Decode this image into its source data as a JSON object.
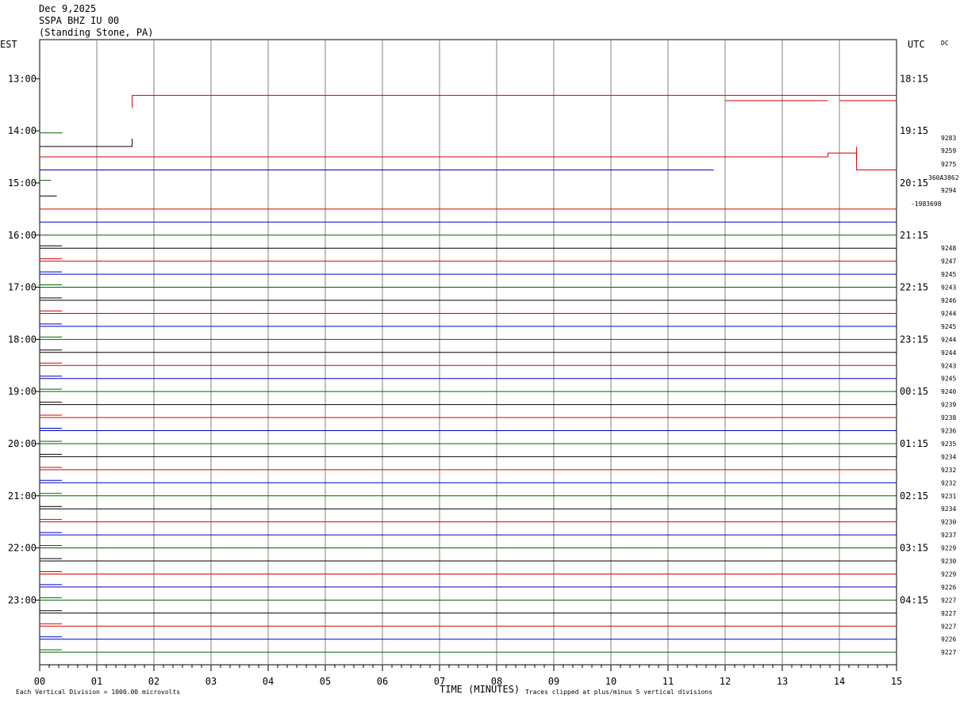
{
  "header": {
    "date": "Dec 9,2025",
    "station": "SSPA BHZ IU 00",
    "location": "(Standing Stone, PA)"
  },
  "labels": {
    "left_zone": "EST",
    "right_zone": "UTC",
    "dc": "DC",
    "xlabel": "TIME (MINUTES)",
    "scale_note": "Each Vertical Division = 1000.00 microvolts",
    "clip_note": "Traces clipped at plus/minus 5 vertical divisions"
  },
  "colors": {
    "black": "#000000",
    "red": "#d40000",
    "blue": "#0000c8",
    "green": "#006400",
    "grid": "#808080"
  },
  "chart_data": {
    "type": "line",
    "x_ticks": [
      "00",
      "01",
      "02",
      "03",
      "04",
      "05",
      "06",
      "07",
      "08",
      "09",
      "10",
      "11",
      "12",
      "13",
      "14",
      "15"
    ],
    "xlim": [
      0,
      15
    ],
    "row_start_hour": 12.25,
    "row_step_hours": 0.25,
    "row_colors": [
      "black",
      "red",
      "blue",
      "green"
    ],
    "left_hour_labels": [
      "13:00",
      "14:00",
      "15:00",
      "16:00",
      "17:00",
      "18:00",
      "19:00",
      "20:00",
      "21:00",
      "22:00",
      "23:00"
    ],
    "right_hour_labels": [
      "18:15",
      "19:15",
      "20:15",
      "21:15",
      "22:15",
      "23:15",
      "00:15",
      "01:15",
      "02:15",
      "03:15",
      "04:15"
    ],
    "right_values": [
      "9283",
      "9259",
      "9275",
      "9294",
      "9248",
      "9247",
      "9245",
      "9243",
      "9246",
      "9244",
      "9245",
      "9244",
      "9244",
      "9243",
      "9245",
      "9240",
      "9239",
      "9238",
      "9236",
      "9235",
      "9234",
      "9232",
      "9232",
      "9231",
      "9234",
      "9230",
      "9237",
      "9229",
      "9230",
      "9229",
      "9226",
      "9227",
      "9227",
      "9227",
      "9226",
      "9227"
    ],
    "overlap_values": [
      "-1983698",
      "360A3862"
    ],
    "traces": [
      {
        "row": 5,
        "segments": [
          [
            1.62,
            -1.1
          ],
          [
            1.62,
            3.6
          ],
          [
            15,
            3.6
          ]
        ]
      },
      {
        "row": 5,
        "segments": [
          [
            12.0,
            1.6
          ],
          [
            13.8,
            1.6
          ]
        ]
      },
      {
        "row": 5,
        "segments": [
          [
            14.0,
            1.6
          ],
          [
            15,
            1.6
          ]
        ]
      },
      {
        "row": 7,
        "segments": [
          [
            0,
            -0.8
          ],
          [
            0.4,
            -0.8
          ]
        ]
      },
      {
        "row": 8,
        "segments": [
          [
            0,
            -1.0
          ],
          [
            1.62,
            -1.0
          ],
          [
            1.62,
            2.0
          ]
        ]
      },
      {
        "row": 9,
        "segments": [
          [
            0,
            0
          ],
          [
            13.8,
            0
          ],
          [
            13.8,
            1.5
          ],
          [
            14.3,
            1.5
          ],
          [
            14.3,
            -5.0
          ],
          [
            15,
            -5.0
          ]
        ]
      },
      {
        "row": 9,
        "segments": [
          [
            14.3,
            3.9
          ],
          [
            14.3,
            -1.0
          ]
        ]
      },
      {
        "row": 10,
        "segments": [
          [
            0,
            0
          ],
          [
            11.8,
            0
          ]
        ]
      },
      {
        "row": 11,
        "segments": [
          [
            0,
            1.0
          ],
          [
            0.2,
            1.0
          ]
        ]
      },
      {
        "row": 12,
        "segments": [
          [
            0,
            0
          ],
          [
            0.3,
            0
          ]
        ]
      },
      {
        "row": 13,
        "segments": [
          [
            0,
            0
          ],
          [
            15,
            0
          ]
        ]
      },
      {
        "row": 14,
        "segments": [
          [
            0,
            0
          ],
          [
            15,
            0
          ]
        ]
      },
      {
        "row": 15,
        "segments": [
          [
            0,
            0
          ],
          [
            15,
            0
          ]
        ]
      }
    ]
  }
}
